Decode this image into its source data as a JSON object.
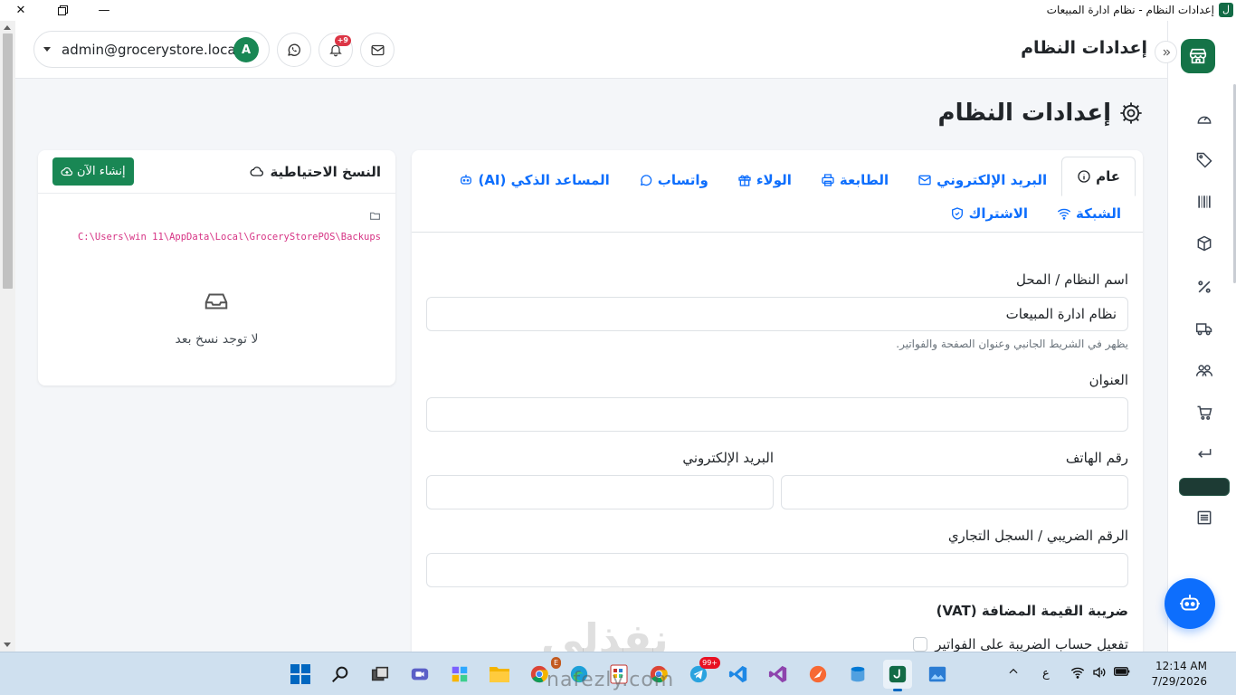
{
  "window": {
    "title": "إعدادات النظام - نظام ادارة المبيعات",
    "app_icon_letter": "ل",
    "minimize": "—",
    "close": "✕"
  },
  "header": {
    "title": "إعدادات النظام",
    "user_email": "admin@grocerystore.local",
    "avatar_letter": "A",
    "notifications_badge": "+9"
  },
  "page": {
    "title": "إعدادات النظام"
  },
  "tabs": [
    {
      "label": "عام",
      "icon": "info-icon",
      "active": true
    },
    {
      "label": "البريد الإلكتروني",
      "icon": "envelope-icon"
    },
    {
      "label": "الطابعة",
      "icon": "printer-icon"
    },
    {
      "label": "الولاء",
      "icon": "gift-icon"
    },
    {
      "label": "واتساب",
      "icon": "whatsapp-icon"
    },
    {
      "label": "المساعد الذكي (AI)",
      "icon": "robot-icon"
    },
    {
      "label": "الشبكة",
      "icon": "wifi-icon"
    },
    {
      "label": "الاشتراك",
      "icon": "shield-icon"
    }
  ],
  "form": {
    "system_name_label": "اسم النظام / المحل",
    "system_name_value": "نظام ادارة المبيعات",
    "system_name_hint": "يظهر في الشريط الجانبي وعنوان الصفحة والفواتير.",
    "address_label": "العنوان",
    "address_value": "",
    "phone_label": "رقم الهاتف",
    "phone_value": "",
    "email_label": "البريد الإلكتروني",
    "email_value": "",
    "tax_label": "الرقم الضريبي / السجل التجاري",
    "tax_value": "",
    "vat_heading": "ضريبة القيمة المضافة (VAT)",
    "vat_enable_label": "تفعيل حساب الضريبة على الفواتير",
    "vat_enabled": false
  },
  "backups": {
    "title": "النسخ الاحتياطية",
    "create_button": "إنشاء الآن",
    "path": "C:\\Users\\win 11\\AppData\\Local\\GroceryStorePOS\\Backups",
    "empty_text": "لا توجد نسخ بعد"
  },
  "watermark": {
    "arabic": "نفذلي",
    "latin": "nafezly.com"
  },
  "taskbar": {
    "chrome_badge": "E",
    "telegram_badge": "99+",
    "keyboard_lang": "ع",
    "time": "12:14 AM",
    "date": "7/29/2026"
  },
  "colors": {
    "primary": "#0d6efd",
    "success": "#198754",
    "sidebar_logo": "#157347",
    "danger": "#dc3545",
    "path_text": "#d63384"
  }
}
